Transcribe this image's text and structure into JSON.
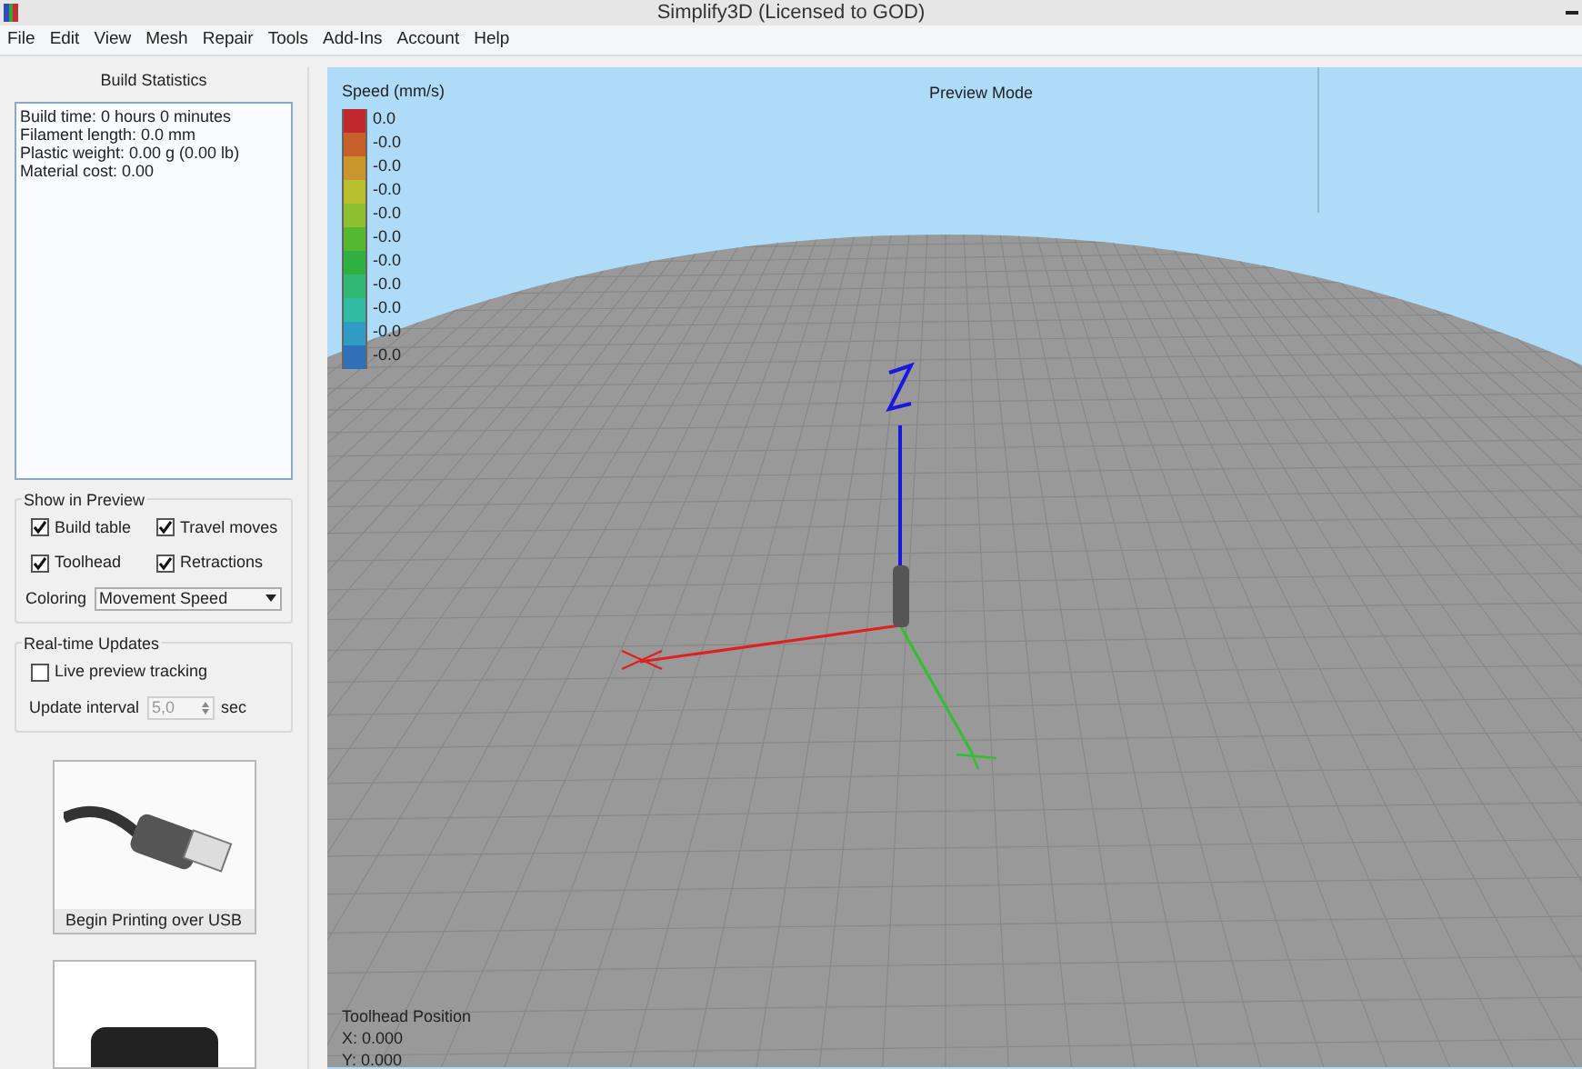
{
  "window": {
    "title": "Simplify3D (Licensed to GOD)"
  },
  "menu": [
    "File",
    "Edit",
    "View",
    "Mesh",
    "Repair",
    "Tools",
    "Add-Ins",
    "Account",
    "Help"
  ],
  "build_statistics": {
    "title": "Build Statistics",
    "lines": [
      "Build time: 0 hours 0 minutes",
      "Filament length: 0.0 mm",
      "Plastic weight: 0.00 g (0.00 lb)",
      "Material cost: 0.00"
    ]
  },
  "show_in_preview": {
    "title": "Show in Preview",
    "options": [
      {
        "label": "Build table",
        "checked": true
      },
      {
        "label": "Travel moves",
        "checked": true
      },
      {
        "label": "Toolhead",
        "checked": true
      },
      {
        "label": "Retractions",
        "checked": true
      }
    ],
    "coloring": {
      "label": "Coloring",
      "value": "Movement Speed"
    }
  },
  "realtime_updates": {
    "title": "Real-time Updates",
    "live_tracking": {
      "label": "Live preview tracking",
      "checked": false
    },
    "update_interval": {
      "label": "Update interval",
      "value": "5,0",
      "unit": "sec"
    }
  },
  "actions": [
    {
      "label": "Begin Printing over USB"
    }
  ],
  "viewport": {
    "mode": "Preview Mode",
    "legend": {
      "title": "Speed (mm/s)",
      "entries": [
        {
          "label": "0.0",
          "color": "#c0282e"
        },
        {
          "label": "-0.0",
          "color": "#c8602c"
        },
        {
          "label": "-0.0",
          "color": "#c8962c"
        },
        {
          "label": "-0.0",
          "color": "#b8c02e"
        },
        {
          "label": "-0.0",
          "color": "#8cc030"
        },
        {
          "label": "-0.0",
          "color": "#54b830"
        },
        {
          "label": "-0.0",
          "color": "#30b040"
        },
        {
          "label": "-0.0",
          "color": "#30b874"
        },
        {
          "label": "-0.0",
          "color": "#30bca4"
        },
        {
          "label": "-0.0",
          "color": "#309cc4"
        },
        {
          "label": "-0.0",
          "color": "#3070b8"
        }
      ]
    },
    "toolhead_position": {
      "title": "Toolhead Position",
      "lines": [
        "X: 0.000",
        "Y: 0.000"
      ]
    }
  }
}
